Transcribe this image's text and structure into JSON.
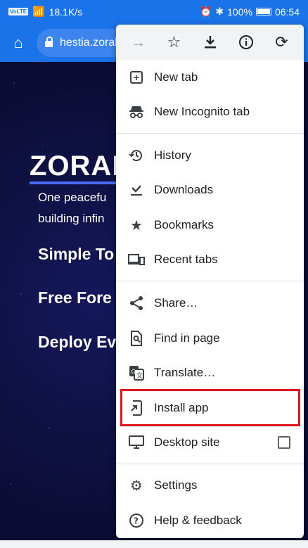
{
  "status_bar": {
    "volte": "VoLTE",
    "network_speed": "18.1K/s",
    "battery_percent": "100%",
    "time": "06:54"
  },
  "toolbar": {
    "url_text": "hestia.zoral"
  },
  "page": {
    "hero_title": "ZORAL",
    "hero_sub_lines": [
      "One peacefu",
      "building infin"
    ],
    "features": [
      "Simple To",
      "Free Fore",
      "Deploy Ev"
    ]
  },
  "menu": {
    "top_icons": [
      "forward-arrow-icon",
      "star-icon",
      "download-icon",
      "info-icon",
      "refresh-icon"
    ],
    "items": [
      {
        "label": "New tab",
        "icon": "new-tab-icon"
      },
      {
        "label": "New Incognito tab",
        "icon": "incognito-icon"
      },
      {
        "label": "History",
        "icon": "history-icon"
      },
      {
        "label": "Downloads",
        "icon": "downloads-icon"
      },
      {
        "label": "Bookmarks",
        "icon": "bookmarks-star-icon"
      },
      {
        "label": "Recent tabs",
        "icon": "recent-tabs-icon"
      },
      {
        "label": "Share…",
        "icon": "share-icon"
      },
      {
        "label": "Find in page",
        "icon": "find-in-page-icon"
      },
      {
        "label": "Translate…",
        "icon": "translate-icon"
      },
      {
        "label": "Install app",
        "icon": "install-app-icon"
      },
      {
        "label": "Desktop site",
        "icon": "desktop-icon",
        "checked": false
      },
      {
        "label": "Settings",
        "icon": "settings-gear-icon"
      },
      {
        "label": "Help & feedback",
        "icon": "help-icon"
      }
    ]
  },
  "colors": {
    "accent": "#1a73e8",
    "highlight": "#e0141e"
  }
}
